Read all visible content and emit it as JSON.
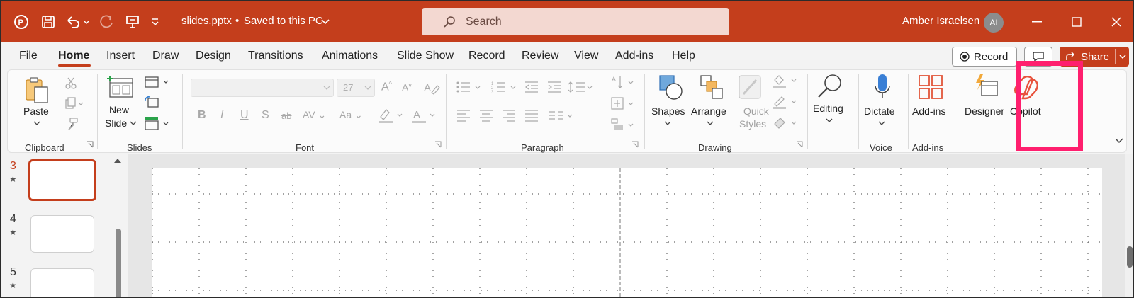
{
  "title_bar": {
    "file_name": "slides.pptx",
    "separator": "•",
    "save_status": "Saved to this PC",
    "search_placeholder": "Search",
    "user_name": "Amber Israelsen",
    "user_initials": "AI"
  },
  "tabs": [
    "File",
    "Home",
    "Insert",
    "Draw",
    "Design",
    "Transitions",
    "Animations",
    "Slide Show",
    "Record",
    "Review",
    "View",
    "Add-ins",
    "Help"
  ],
  "active_tab": "Home",
  "right_buttons": {
    "record_label": "Record",
    "share_label": "Share"
  },
  "ribbon": {
    "clipboard": {
      "paste_label": "Paste",
      "group_label": "Clipboard"
    },
    "slides": {
      "new_slide_line1": "New",
      "new_slide_line2": "Slide",
      "group_label": "Slides"
    },
    "font": {
      "font_size_value": "27",
      "group_label": "Font"
    },
    "paragraph": {
      "group_label": "Paragraph"
    },
    "drawing": {
      "shapes_label": "Shapes",
      "arrange_label": "Arrange",
      "quick_styles_line1": "Quick",
      "quick_styles_line2": "Styles",
      "group_label": "Drawing"
    },
    "editing": {
      "editing_label": "Editing"
    },
    "voice": {
      "dictate_label": "Dictate",
      "group_label": "Voice"
    },
    "addins": {
      "addins_label": "Add-ins",
      "group_label": "Add-ins"
    },
    "designer": {
      "designer_label": "Designer"
    },
    "copilot": {
      "copilot_label": "Copilot"
    }
  },
  "slide_pane": {
    "slides": [
      {
        "number": "3",
        "star": "★",
        "selected": true
      },
      {
        "number": "4",
        "star": "★",
        "selected": false
      },
      {
        "number": "5",
        "star": "★",
        "selected": false
      }
    ]
  },
  "colors": {
    "accent": "#c43e1c",
    "highlight": "#ff1f6e",
    "copilot_icon": "#e8533d"
  }
}
